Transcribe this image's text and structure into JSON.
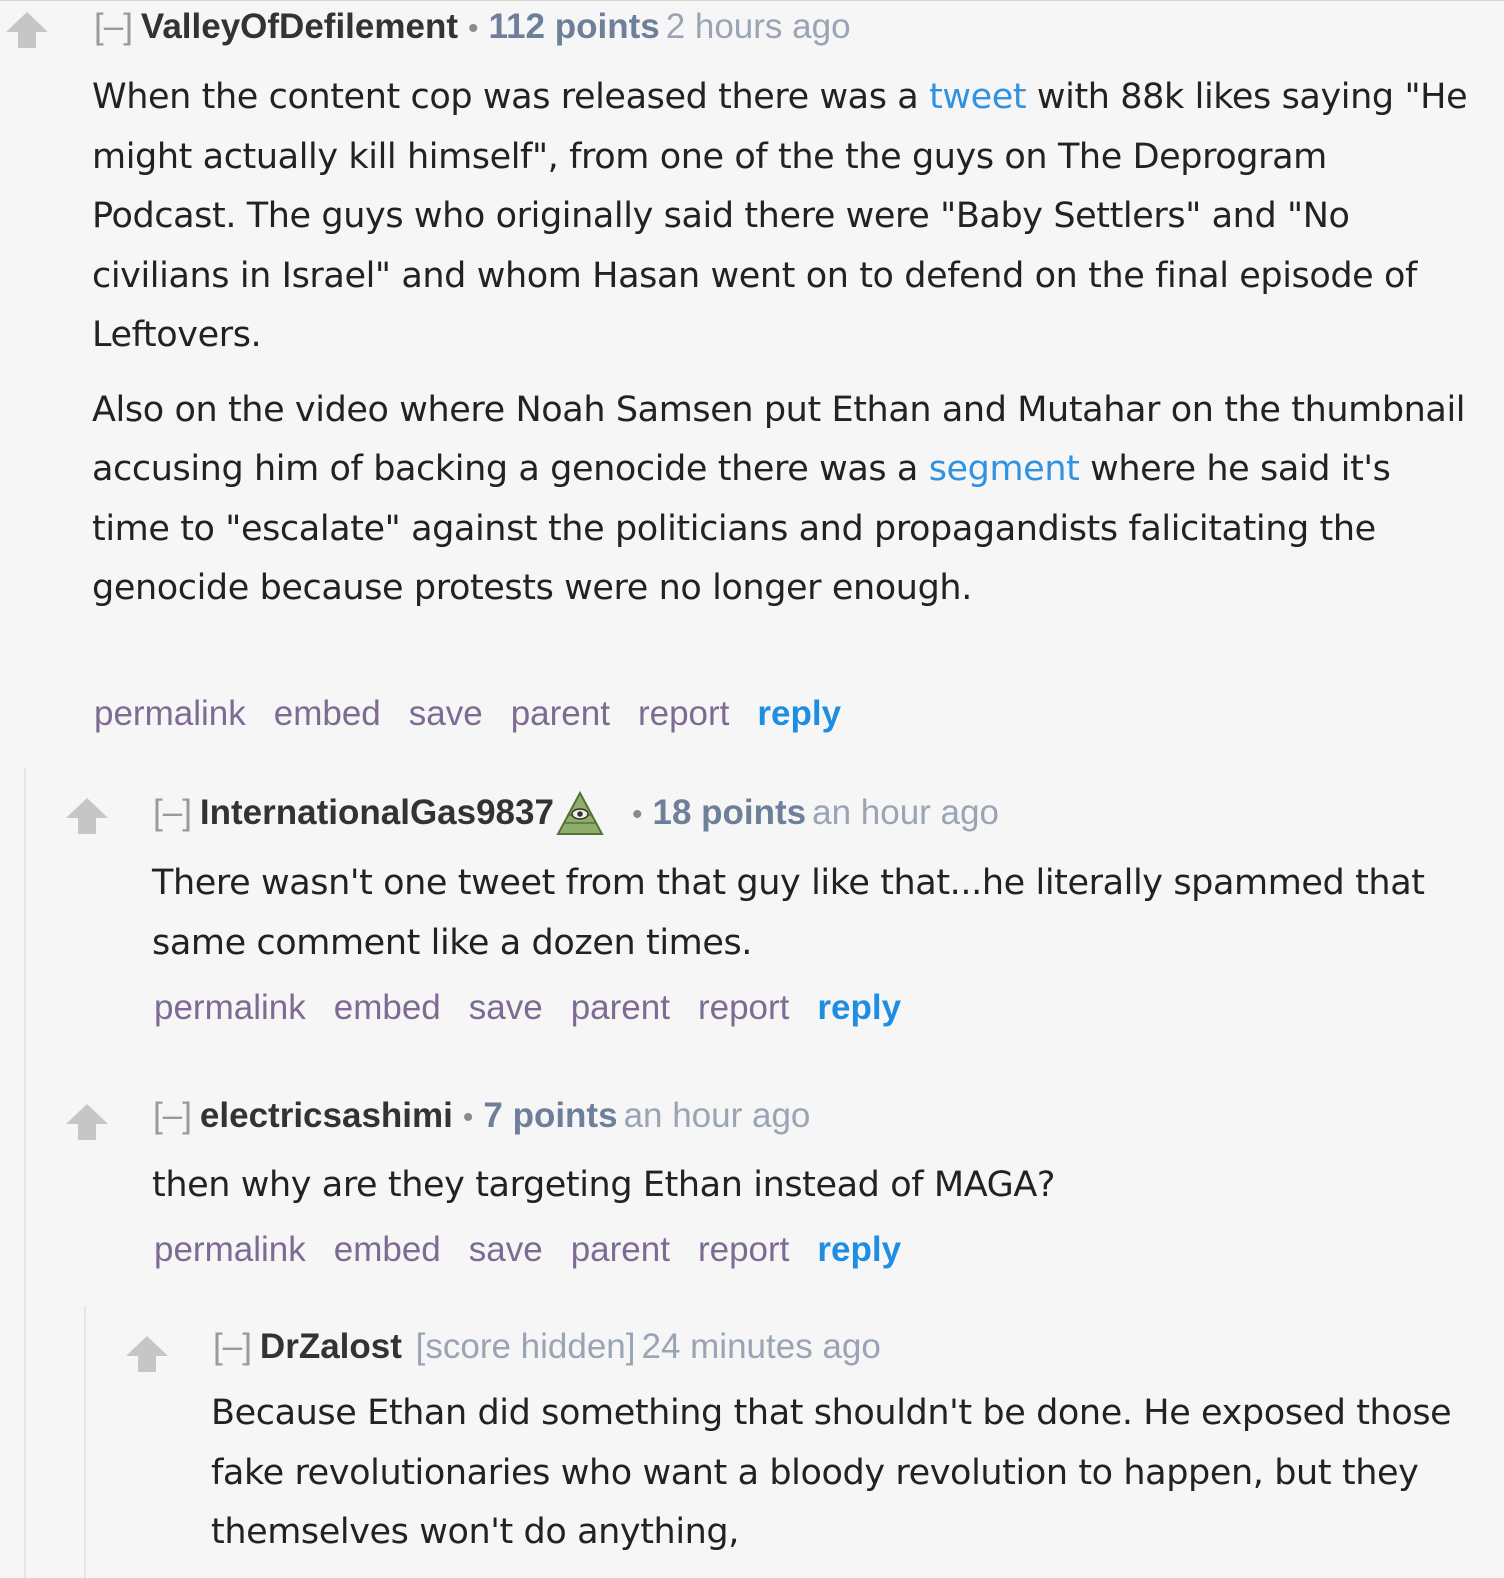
{
  "comments": [
    {
      "toggle": "[–]",
      "author": "ValleyOfDefilement",
      "separator": "•",
      "score": "112 points",
      "time": "2 hours ago",
      "paragraphs": [
        {
          "before": "When the content cop was released there was a ",
          "link": "tweet",
          "after": " with 88k likes saying \"He might actually kill himself\", from one of the the guys on The Deprogram Podcast. The guys who originally said there were \"Baby Settlers\" and \"No civilians in Israel\" and whom Hasan went on to defend on the final episode of Leftovers."
        },
        {
          "before": "Also on the video where Noah Samsen put Ethan and Mutahar on the thumbnail accusing him of backing a genocide there was a ",
          "link": "segment",
          "after": " where he said it's time to \"escalate\" against the politicians and propagandists falicitating the genocide because protests were no longer enough."
        }
      ]
    },
    {
      "toggle": "[–]",
      "author": "InternationalGas9837",
      "flair_icon": "illuminati-eye-icon",
      "separator": "•",
      "score": "18 points",
      "time": "an hour ago",
      "text": "There wasn't one tweet from that guy like that...he literally spammed that same comment like a dozen times."
    },
    {
      "toggle": "[–]",
      "author": "electricsashimi",
      "separator": "•",
      "score": "7 points",
      "time": "an hour ago",
      "text": "then why are they targeting Ethan instead of MAGA?"
    },
    {
      "toggle": "[–]",
      "author": "DrZalost",
      "hidden_score": "[score hidden]",
      "time": "24 minutes ago",
      "text": "Because Ethan did something that shouldn't be done. He exposed those fake revolutionaries who want a bloody revolution to happen, but they themselves won't do anything,"
    }
  ],
  "buttons": {
    "permalink": "permalink",
    "embed": "embed",
    "save": "save",
    "parent": "parent",
    "report": "report",
    "reply": "reply"
  },
  "colors": {
    "background": "#f6f6f6",
    "link": "#3092e0",
    "action": "#7d6b94",
    "reply": "#1e8ee3",
    "score": "#6d7f99"
  }
}
